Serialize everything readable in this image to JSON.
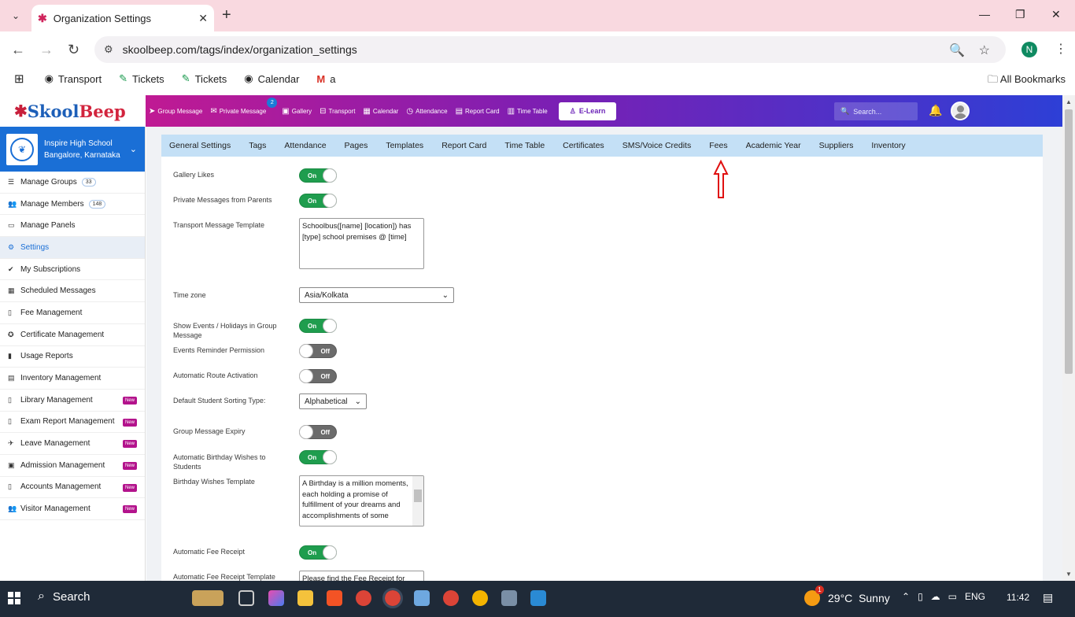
{
  "browser": {
    "tab_title": "Organization Settings",
    "url": "skoolbeep.com/tags/index/organization_settings",
    "profile_initial": "N",
    "bookmarks": [
      "Transport",
      "Tickets",
      "Tickets",
      "Calendar",
      "a"
    ],
    "all_bookmarks": "All Bookmarks"
  },
  "app": {
    "logo_skool": "Skool",
    "logo_beep": "Beep",
    "topnav": [
      {
        "label": "Group Message",
        "icon": "send-icon"
      },
      {
        "label": "Private Message",
        "icon": "envelope-icon",
        "badge": "2"
      },
      {
        "label": "Gallery",
        "icon": "image-icon"
      },
      {
        "label": "Transport",
        "icon": "bus-icon"
      },
      {
        "label": "Calendar",
        "icon": "calendar-icon"
      },
      {
        "label": "Attendance",
        "icon": "clock-icon"
      },
      {
        "label": "Report Card",
        "icon": "document-icon"
      },
      {
        "label": "Time Table",
        "icon": "timetable-icon"
      }
    ],
    "elearn": "E-Learn",
    "search_placeholder": "Search..."
  },
  "sidebar": {
    "school_name": "Inspire High School",
    "school_location": "Bangalore, Karnataka",
    "items": [
      {
        "label": "Manage Groups",
        "count": "33"
      },
      {
        "label": "Manage Members",
        "count": "148"
      },
      {
        "label": "Manage Panels"
      },
      {
        "label": "Settings",
        "active": true
      },
      {
        "label": "My Subscriptions"
      },
      {
        "label": "Scheduled Messages"
      },
      {
        "label": "Fee Management"
      },
      {
        "label": "Certificate Management"
      },
      {
        "label": "Usage Reports"
      },
      {
        "label": "Inventory Management"
      },
      {
        "label": "Library Management",
        "new": "New"
      },
      {
        "label": "Exam Report Management",
        "new": "New"
      },
      {
        "label": "Leave Management",
        "new": "New"
      },
      {
        "label": "Admission Management",
        "new": "New"
      },
      {
        "label": "Accounts Management",
        "new": "New"
      },
      {
        "label": "Visitor Management",
        "new": "New"
      }
    ]
  },
  "subtabs": [
    "General Settings",
    "Tags",
    "Attendance",
    "Pages",
    "Templates",
    "Report Card",
    "Time Table",
    "Certificates",
    "SMS/Voice Credits",
    "Fees",
    "Academic Year",
    "Suppliers",
    "Inventory"
  ],
  "settings": {
    "gallery_likes": {
      "label": "Gallery Likes",
      "state": "On"
    },
    "private_messages": {
      "label": "Private Messages from Parents",
      "state": "On"
    },
    "transport_template": {
      "label": "Transport Message Template",
      "value": "Schoolbus([name] [location]) has [type] school premises @ [time]"
    },
    "time_zone": {
      "label": "Time zone",
      "value": "Asia/Kolkata"
    },
    "show_events": {
      "label": "Show Events / Holidays in Group Message",
      "state": "On"
    },
    "events_reminder": {
      "label": "Events Reminder Permission",
      "state": "Off"
    },
    "auto_route": {
      "label": "Automatic Route Activation",
      "state": "Off"
    },
    "sorting_type": {
      "label": "Default Student Sorting Type:",
      "value": "Alphabetical"
    },
    "group_expiry": {
      "label": "Group Message Expiry",
      "state": "Off"
    },
    "birthday_wishes": {
      "label": "Automatic Birthday Wishes to Students",
      "state": "On"
    },
    "birthday_template": {
      "label": "Birthday Wishes Template",
      "value": "A Birthday is a million moments, each holding a promise of fulfillment of your dreams and accomplishments of some"
    },
    "fee_receipt": {
      "label": "Automatic Fee Receipt",
      "state": "On"
    },
    "fee_receipt_template": {
      "label": "Automatic Fee Receipt Template",
      "value": "Please find the Fee Receipt for"
    }
  },
  "taskbar": {
    "search": "Search",
    "temperature": "29°C",
    "weather": "Sunny",
    "weather_badge": "1",
    "lang": "ENG",
    "time": "11:42"
  }
}
